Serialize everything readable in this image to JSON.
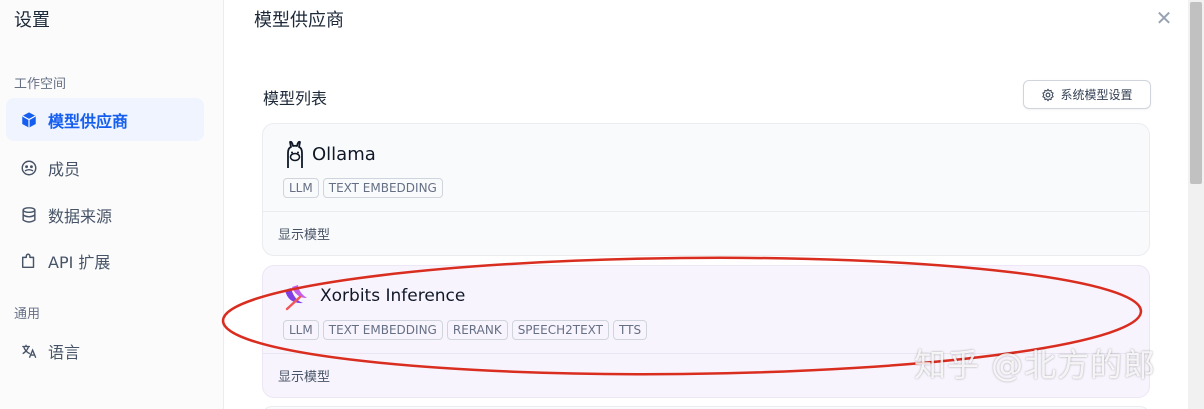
{
  "sidebar": {
    "title": "设置",
    "workspace_label": "工作空间",
    "general_label": "通用",
    "items": [
      {
        "label": "模型供应商",
        "icon": "cube-icon",
        "active": true
      },
      {
        "label": "成员",
        "icon": "members-icon",
        "active": false
      },
      {
        "label": "数据来源",
        "icon": "database-icon",
        "active": false
      },
      {
        "label": "API 扩展",
        "icon": "puzzle-icon",
        "active": false
      },
      {
        "label": "语言",
        "icon": "translate-icon",
        "active": false
      }
    ]
  },
  "main": {
    "title": "模型供应商",
    "list_title": "模型列表",
    "system_settings_button": "系统模型设置",
    "providers": [
      {
        "name": "Ollama",
        "tags": [
          "LLM",
          "TEXT EMBEDDING"
        ],
        "show_models": "显示模型",
        "logo": "ollama-logo-icon"
      },
      {
        "name": "Xorbits Inference",
        "tags": [
          "LLM",
          "TEXT EMBEDDING",
          "RERANK",
          "SPEECH2TEXT",
          "TTS"
        ],
        "show_models": "显示模型",
        "logo": "xorbits-logo-icon"
      }
    ]
  },
  "watermark": "知乎 @北方的郎",
  "colors": {
    "accent": "#155eef",
    "annotation": "#d92d20",
    "active_bg": "#eff4ff"
  }
}
